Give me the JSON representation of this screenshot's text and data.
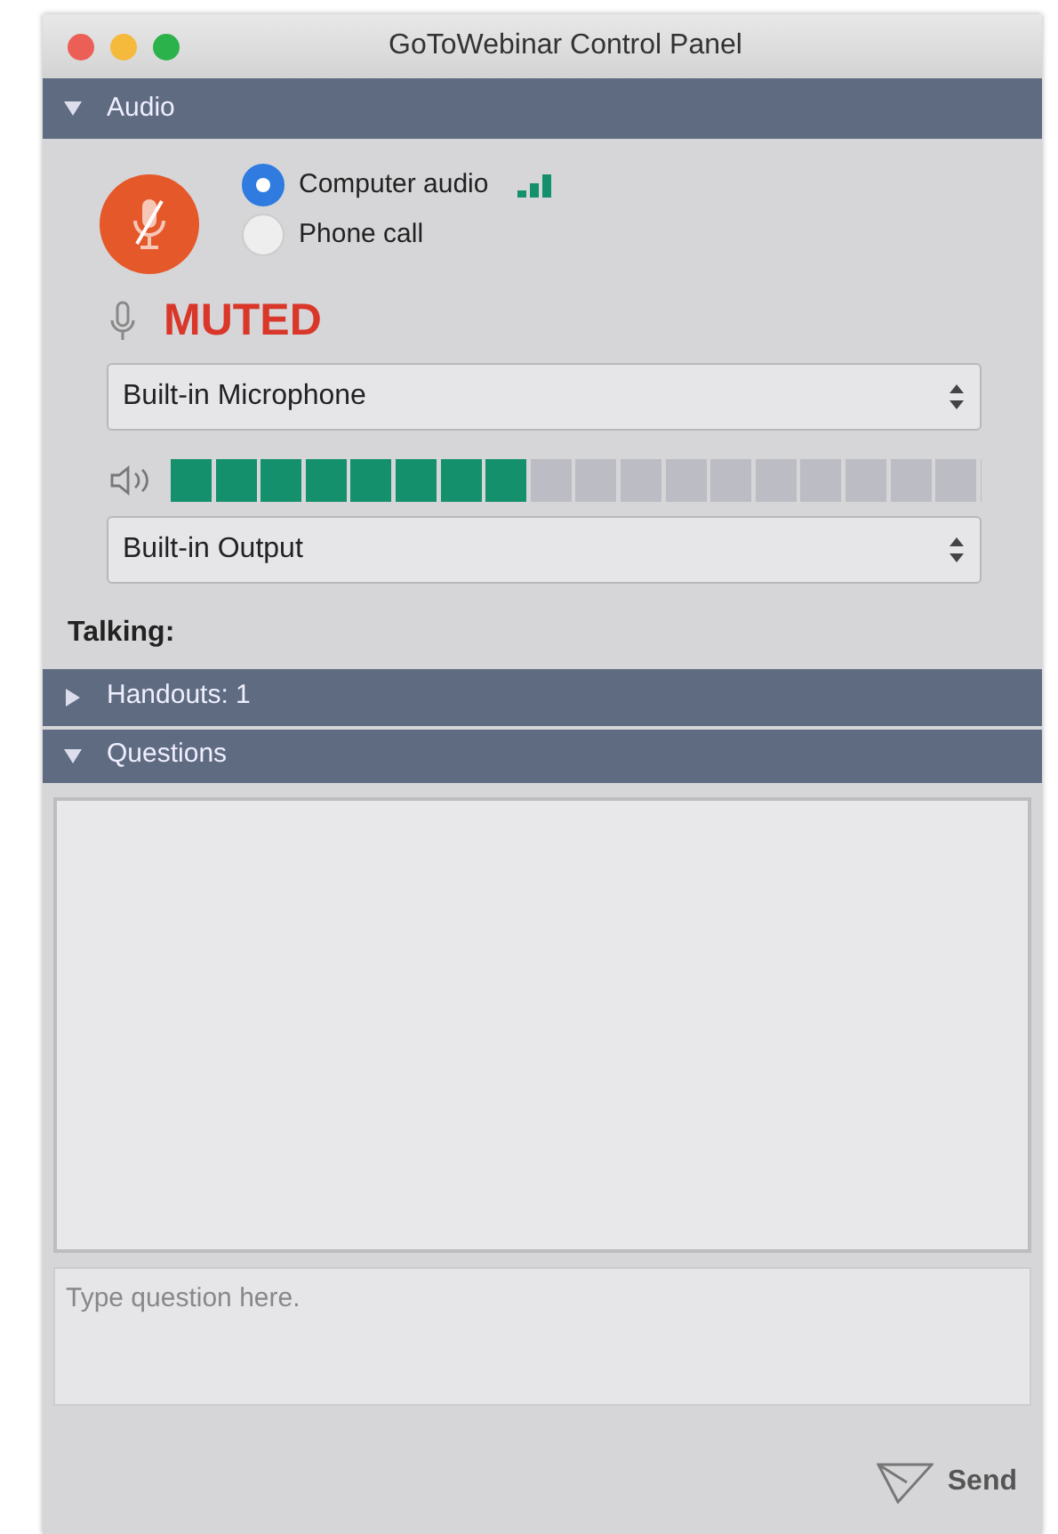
{
  "window": {
    "title": "GoToWebinar Control Panel"
  },
  "audio": {
    "title": "Audio",
    "expanded": true,
    "muted": true,
    "options": [
      {
        "label": "Computer audio",
        "selected": true
      },
      {
        "label": "Phone call",
        "selected": false
      }
    ],
    "status": "MUTED",
    "microphone": "Built-in Microphone",
    "speaker_meter": {
      "level": 0.444
    },
    "output": "Built-in Output",
    "talking_label": "Talking:"
  },
  "handouts": {
    "title": "Handouts: 1",
    "expanded": false
  },
  "questions": {
    "title": "Questions",
    "expanded": true,
    "placeholder": "Type question here.",
    "send": "Send"
  }
}
